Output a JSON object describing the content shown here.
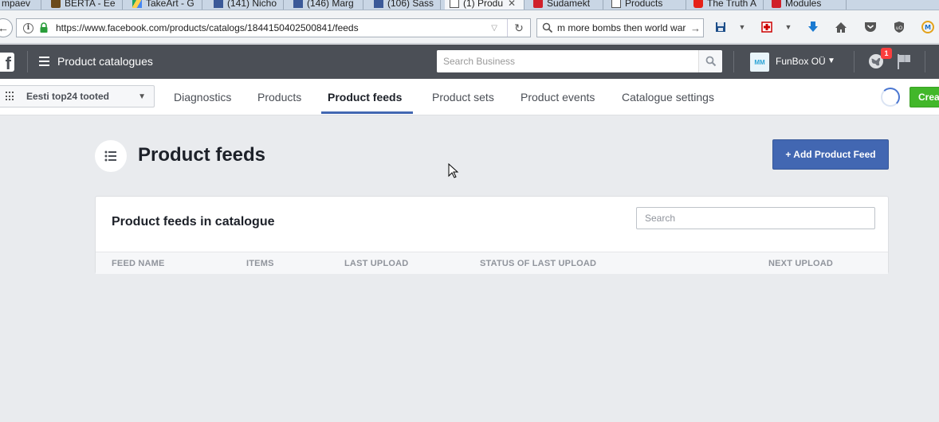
{
  "browser": {
    "tabs": [
      {
        "label": "mpaev",
        "icon": "none"
      },
      {
        "label": "BERTA - Ee",
        "icon": "berta-icon"
      },
      {
        "label": "TakeArt - G",
        "icon": "drive-icon"
      },
      {
        "label": "(141) Nicho",
        "icon": "facebook-icon"
      },
      {
        "label": "(146) Marg",
        "icon": "facebook-icon"
      },
      {
        "label": "(106) Sass",
        "icon": "facebook-icon"
      },
      {
        "label": "(1) Produ",
        "icon": "page-icon"
      },
      {
        "label": "Sudamekt",
        "icon": "sudamekt-icon"
      },
      {
        "label": "Products",
        "icon": "page-icon"
      },
      {
        "label": "The Truth A",
        "icon": "youtube-icon"
      },
      {
        "label": "Modules",
        "icon": "modules-icon"
      }
    ],
    "url": "https://www.facebook.com/products/catalogs/1844150402500841/feeds",
    "search_query": "m more bombs then world war"
  },
  "header": {
    "title": "Product catalogues",
    "business_search_placeholder": "Search Business",
    "business_avatar": "MM",
    "business_name": "FunBox OÜ",
    "notification_count": "1"
  },
  "subnav": {
    "catalogue_name": "Eesti top24 tooted",
    "tabs": [
      "Diagnostics",
      "Products",
      "Product feeds",
      "Product sets",
      "Product events",
      "Catalogue settings"
    ],
    "active_tab": "Product feeds",
    "create_label": "Crea"
  },
  "main": {
    "page_title": "Product feeds",
    "add_button_label": "+ Add Product Feed",
    "panel": {
      "title": "Product feeds in catalogue",
      "search_placeholder": "Search",
      "columns": [
        "FEED NAME",
        "ITEMS",
        "LAST UPLOAD",
        "STATUS OF LAST UPLOAD",
        "NEXT UPLOAD"
      ]
    }
  },
  "colors": {
    "fb_bar": "#4b4f56",
    "accent_blue": "#4267b2",
    "create_green": "#42b72a",
    "page_bg": "#e9ebee"
  }
}
